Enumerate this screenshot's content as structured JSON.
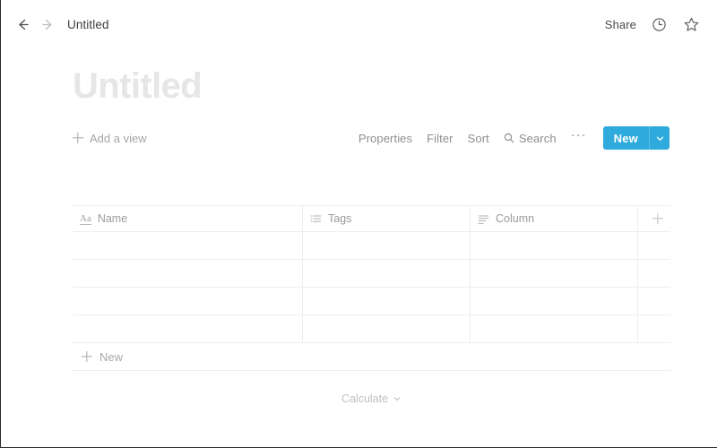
{
  "window": {
    "accent_color": "#2eaadc",
    "background": "#ffffff"
  },
  "topbar": {
    "back_icon": "arrow-left-icon",
    "forward_icon": "arrow-right-icon",
    "breadcrumb": "Untitled",
    "share_label": "Share",
    "history_icon": "clock-icon",
    "favorite_icon": "star-icon"
  },
  "page": {
    "title": "Untitled"
  },
  "view_toolbar": {
    "add_view_label": "Add a view",
    "add_view_icon": "plus-icon",
    "properties_label": "Properties",
    "filter_label": "Filter",
    "sort_label": "Sort",
    "search_label": "Search",
    "search_icon": "search-icon",
    "more_label": "···",
    "new_label": "New",
    "new_caret_icon": "chevron-down-icon"
  },
  "table": {
    "columns": [
      {
        "label": "Name",
        "icon": "title-text-icon",
        "icon_glyph": "Aa"
      },
      {
        "label": "Tags",
        "icon": "multi-select-icon"
      },
      {
        "label": "Column",
        "icon": "text-lines-icon"
      }
    ],
    "add_column_icon": "plus-icon",
    "rows": [
      {
        "name": "",
        "tags": "",
        "column": ""
      },
      {
        "name": "",
        "tags": "",
        "column": ""
      },
      {
        "name": "",
        "tags": "",
        "column": ""
      },
      {
        "name": "",
        "tags": "",
        "column": ""
      }
    ],
    "new_row_label": "New",
    "new_row_icon": "plus-icon",
    "calculate_label": "Calculate",
    "calculate_icon": "chevron-down-icon"
  }
}
